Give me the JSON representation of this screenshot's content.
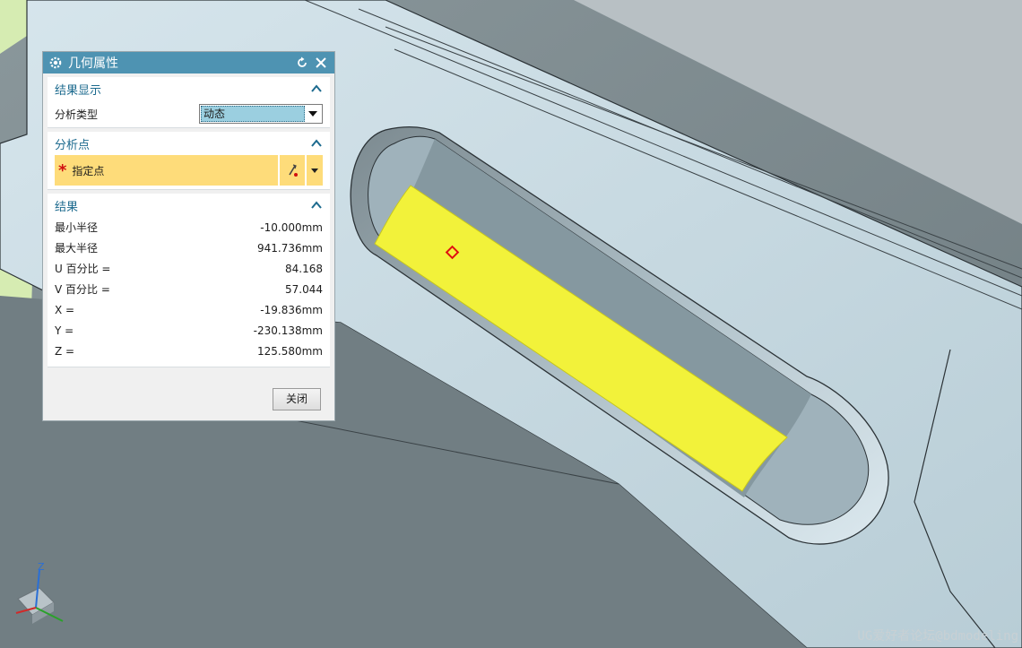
{
  "dialog": {
    "title": "几何属性",
    "sections": {
      "display": {
        "title": "结果显示",
        "analysis_type_label": "分析类型",
        "analysis_type_value": "动态"
      },
      "point": {
        "title": "分析点",
        "specify_label": "指定点"
      },
      "results": {
        "title": "结果",
        "rows": [
          {
            "label": "最小半径",
            "value": "-10.000mm"
          },
          {
            "label": "最大半径",
            "value": "941.736mm"
          },
          {
            "label": "U 百分比 =",
            "value": "84.168"
          },
          {
            "label": "V 百分比 =",
            "value": "57.044"
          },
          {
            "label": "X =",
            "value": "-19.836mm"
          },
          {
            "label": "Y =",
            "value": "-230.138mm"
          },
          {
            "label": "Z =",
            "value": "125.580mm"
          }
        ]
      }
    },
    "close_label": "关闭"
  },
  "triad": {
    "z_label": "Z"
  },
  "watermark": "UG爱好者论坛@bdmodeling",
  "colors": {
    "title_bar": "#4e93b2",
    "selection_highlight": "#fedc7a",
    "highlighted_face": "#f2f23a",
    "part_body": "#c9dbe3"
  }
}
